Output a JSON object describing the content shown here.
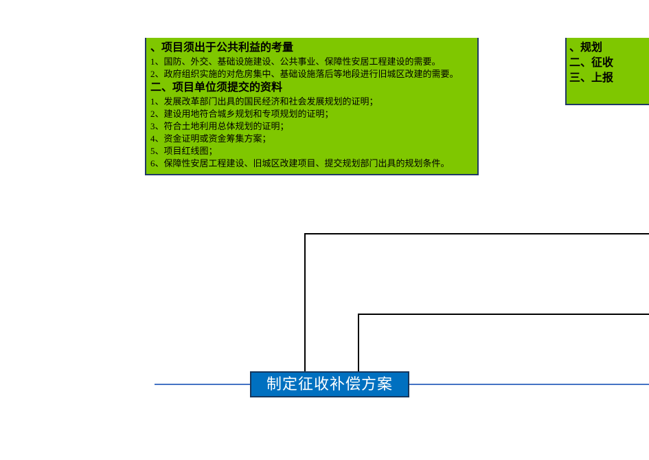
{
  "leftBox": {
    "heading1_partial": "、项目须出于公共利益的考量",
    "item1_1": "1、国防、外交、基础设施建设、公共事业、保障性安居工程建设的需要。",
    "item1_2": "2、政府组织实施的对危房集中、基础设施落后等地段进行旧城区改建的需要。",
    "heading2": "二、项目单位须提交的资料",
    "item2_1": "1、发展改革部门出具的国民经济和社会发展规划的证明；",
    "item2_2": "2、建设用地符合城乡规划和专项规划的证明；",
    "item2_3": "3、符合土地利用总体规划的证明；",
    "item2_4": "4、资金证明或资金筹集方案；",
    "item2_5": "5、项目红线图；",
    "item2_6": "6、保障性安居工程建设、旧城区改建项目、提交规划部门出具的规划条件。"
  },
  "rightBox": {
    "line1_partial": "、规划",
    "line2": "二、征收",
    "line3": "三、上报"
  },
  "blueBox": {
    "label": "制定征收补偿方案"
  }
}
